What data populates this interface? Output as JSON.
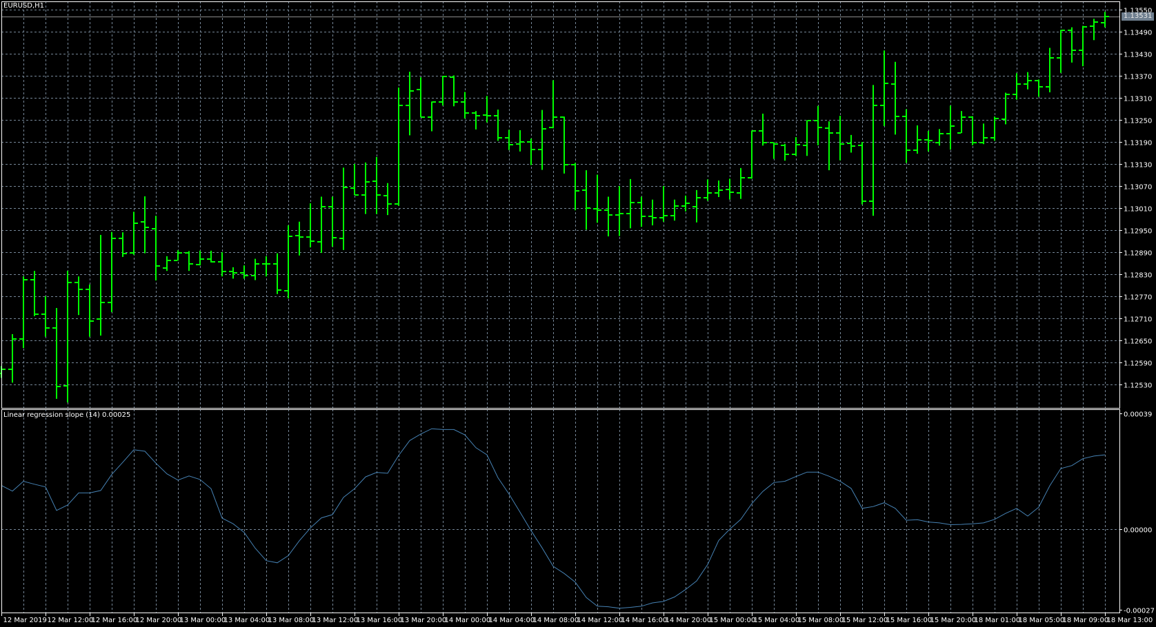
{
  "window": {
    "symbol_label": "EURUSD,H1"
  },
  "colors": {
    "background": "#000000",
    "grid": "#778899",
    "bars": "#00ff00",
    "indicator": "#4682b4",
    "axis": "#ffffff",
    "bid_line": "#8c8c8c"
  },
  "price_axis": {
    "labels": [
      "1.13550",
      "1.13490",
      "1.13430",
      "1.13370",
      "1.13310",
      "1.13250",
      "1.13190",
      "1.13130",
      "1.13070",
      "1.13010",
      "1.12950",
      "1.12890",
      "1.12830",
      "1.12770",
      "1.12710",
      "1.12650",
      "1.12590",
      "1.12530"
    ],
    "bid_price": "1.13531"
  },
  "indicator": {
    "title": "Linear regression slope (14) 0.00025",
    "axis_labels": [
      "0.00039",
      "0.00000",
      "-0.00027"
    ],
    "axis_values": [
      0.00039,
      0.0,
      -0.00027
    ],
    "values": [
      0.000147,
      0.000128,
      0.000161,
      0.000151,
      0.000142,
      6.3e-05,
      8.1e-05,
      0.000122,
      0.000122,
      0.00013,
      0.000184,
      0.000225,
      0.000267,
      0.000262,
      0.000222,
      0.000186,
      0.000165,
      0.000179,
      0.000167,
      0.000136,
      3.7e-05,
      1.8e-05,
      -1.1e-05,
      -6.4e-05,
      -0.000106,
      -0.000113,
      -8.9e-05,
      -3.9e-05,
      4e-06,
      3.8e-05,
      4.9e-05,
      0.000107,
      0.000136,
      0.000176,
      0.000191,
      0.000188,
      0.000248,
      0.000298,
      0.00032,
      0.000338,
      0.000335,
      0.000335,
      0.000317,
      0.000274,
      0.00025,
      0.000173,
      0.000118,
      5.7e-05,
      -5e-06,
      -6.3e-05,
      -0.000125,
      -0.000149,
      -0.000178,
      -0.00023,
      -0.000259,
      -0.000261,
      -0.000266,
      -0.000263,
      -0.000259,
      -0.000248,
      -0.000243,
      -0.000228,
      -0.000203,
      -0.000174,
      -0.000119,
      -3.8e-05,
      0.0,
      3.3e-05,
      8.6e-05,
      0.000127,
      0.000157,
      0.000161,
      0.000177,
      0.000192,
      0.000192,
      0.000178,
      0.000161,
      0.000137,
      7e-05,
      7.6e-05,
      8.9e-05,
      7e-05,
      3e-05,
      3.2e-05,
      2.4e-05,
      2.1e-05,
      1.5e-05,
      1.6e-05,
      1.8e-05,
      2.1e-05,
      3.3e-05,
      5.3e-05,
      7e-05,
      4.4e-05,
      7.4e-05,
      0.000146,
      0.000204,
      0.000214,
      0.000237,
      0.000246,
      0.00025
    ]
  },
  "time_axis": {
    "labels": [
      "12 Mar 2019",
      "12 Mar 12:00",
      "12 Mar 16:00",
      "12 Mar 20:00",
      "13 Mar 00:00",
      "13 Mar 04:00",
      "13 Mar 08:00",
      "13 Mar 12:00",
      "13 Mar 16:00",
      "13 Mar 20:00",
      "14 Mar 00:00",
      "14 Mar 04:00",
      "14 Mar 08:00",
      "14 Mar 12:00",
      "14 Mar 16:00",
      "14 Mar 20:00",
      "15 Mar 00:00",
      "15 Mar 04:00",
      "15 Mar 08:00",
      "15 Mar 12:00",
      "15 Mar 16:00",
      "15 Mar 20:00",
      "18 Mar 01:00",
      "18 Mar 05:00",
      "18 Mar 09:00",
      "18 Mar 13:00"
    ],
    "bars_per_label": 4
  },
  "chart_data": {
    "type": "ohlc",
    "title": "EURUSD,H1",
    "price_range": [
      1.1247,
      1.13572
    ],
    "ohlc": [
      [
        1.1256,
        1.1258,
        1.12548,
        1.12571
      ],
      [
        1.12572,
        1.12667,
        1.12535,
        1.12653
      ],
      [
        1.12653,
        1.12824,
        1.12629,
        1.12815
      ],
      [
        1.12815,
        1.12839,
        1.12716,
        1.12722
      ],
      [
        1.12722,
        1.1277,
        1.1266,
        1.12683
      ],
      [
        1.12683,
        1.12738,
        1.12491,
        1.12525
      ],
      [
        1.12527,
        1.12839,
        1.12481,
        1.12808
      ],
      [
        1.12807,
        1.12824,
        1.12719,
        1.12789
      ],
      [
        1.12789,
        1.12802,
        1.1266,
        1.12703
      ],
      [
        1.12708,
        1.12937,
        1.12663,
        1.12754
      ],
      [
        1.12754,
        1.12945,
        1.12727,
        1.12928
      ],
      [
        1.12928,
        1.12944,
        1.12877,
        1.12887
      ],
      [
        1.12889,
        1.13,
        1.12883,
        1.12969
      ],
      [
        1.12972,
        1.13042,
        1.12887,
        1.12957
      ],
      [
        1.12953,
        1.12989,
        1.12813,
        1.12853
      ],
      [
        1.12846,
        1.12879,
        1.12839,
        1.12868
      ],
      [
        1.12868,
        1.12895,
        1.12867,
        1.12889
      ],
      [
        1.12889,
        1.12893,
        1.12839,
        1.12859
      ],
      [
        1.12857,
        1.12894,
        1.12854,
        1.12872
      ],
      [
        1.12872,
        1.12894,
        1.12862,
        1.12864
      ],
      [
        1.12864,
        1.1289,
        1.12824,
        1.12837
      ],
      [
        1.12837,
        1.12849,
        1.12818,
        1.12834
      ],
      [
        1.12834,
        1.12854,
        1.12818,
        1.12826
      ],
      [
        1.12826,
        1.12872,
        1.12814,
        1.12859
      ],
      [
        1.12859,
        1.12879,
        1.12824,
        1.12859
      ],
      [
        1.12859,
        1.12887,
        1.12776,
        1.12786
      ],
      [
        1.12785,
        1.12963,
        1.12764,
        1.12934
      ],
      [
        1.12935,
        1.12973,
        1.12881,
        1.12931
      ],
      [
        1.12931,
        1.13023,
        1.12903,
        1.1292
      ],
      [
        1.12919,
        1.13041,
        1.12888,
        1.13014
      ],
      [
        1.13014,
        1.13041,
        1.12905,
        1.1293
      ],
      [
        1.12928,
        1.1312,
        1.12896,
        1.13066
      ],
      [
        1.13065,
        1.1313,
        1.13045,
        1.13046
      ],
      [
        1.13046,
        1.13134,
        1.12994,
        1.13081
      ],
      [
        1.13084,
        1.13149,
        1.12994,
        1.13046
      ],
      [
        1.13044,
        1.13078,
        1.12991,
        1.13021
      ],
      [
        1.13021,
        1.13338,
        1.13016,
        1.1329
      ],
      [
        1.13289,
        1.13381,
        1.13208,
        1.13329
      ],
      [
        1.13333,
        1.13366,
        1.13257,
        1.13258
      ],
      [
        1.13258,
        1.133,
        1.13219,
        1.13299
      ],
      [
        1.13298,
        1.1337,
        1.13289,
        1.13369
      ],
      [
        1.13366,
        1.13371,
        1.13287,
        1.13299
      ],
      [
        1.13299,
        1.13326,
        1.13254,
        1.13268
      ],
      [
        1.13268,
        1.13274,
        1.13224,
        1.13261
      ],
      [
        1.13264,
        1.13315,
        1.13243,
        1.13261
      ],
      [
        1.13261,
        1.13278,
        1.13193,
        1.13201
      ],
      [
        1.13201,
        1.13223,
        1.13168,
        1.13183
      ],
      [
        1.13185,
        1.13222,
        1.13164,
        1.1319
      ],
      [
        1.1319,
        1.13199,
        1.13127,
        1.1317
      ],
      [
        1.1317,
        1.13277,
        1.13114,
        1.13226
      ],
      [
        1.1323,
        1.13358,
        1.13227,
        1.13258
      ],
      [
        1.13258,
        1.13259,
        1.13104,
        1.13129
      ],
      [
        1.13129,
        1.13133,
        1.13004,
        1.13057
      ],
      [
        1.13058,
        1.13113,
        1.12951,
        1.1301
      ],
      [
        1.13009,
        1.13101,
        1.1297,
        1.13005
      ],
      [
        1.13005,
        1.13041,
        1.12933,
        1.12991
      ],
      [
        1.12991,
        1.1307,
        1.12934,
        1.12995
      ],
      [
        1.12995,
        1.13089,
        1.12955,
        1.13025
      ],
      [
        1.13025,
        1.13041,
        1.12959,
        1.12988
      ],
      [
        1.12988,
        1.13033,
        1.12963,
        1.12983
      ],
      [
        1.12984,
        1.1307,
        1.12973,
        1.1299
      ],
      [
        1.1299,
        1.13033,
        1.12976,
        1.13016
      ],
      [
        1.13016,
        1.13044,
        1.13001,
        1.13024
      ],
      [
        1.13014,
        1.13059,
        1.12971,
        1.13038
      ],
      [
        1.13038,
        1.13088,
        1.1303,
        1.13051
      ],
      [
        1.13051,
        1.13085,
        1.1304,
        1.13058
      ],
      [
        1.1306,
        1.1309,
        1.13033,
        1.13054
      ],
      [
        1.13051,
        1.13119,
        1.13035,
        1.13093
      ],
      [
        1.13092,
        1.13221,
        1.1309,
        1.1322
      ],
      [
        1.1322,
        1.13267,
        1.1318,
        1.13189
      ],
      [
        1.13189,
        1.13189,
        1.13144,
        1.13185
      ],
      [
        1.13181,
        1.13185,
        1.13139,
        1.13156
      ],
      [
        1.13156,
        1.13203,
        1.13152,
        1.13183
      ],
      [
        1.13181,
        1.13249,
        1.13152,
        1.13249
      ],
      [
        1.13249,
        1.13288,
        1.13181,
        1.1323
      ],
      [
        1.13228,
        1.13246,
        1.13113,
        1.13215
      ],
      [
        1.13215,
        1.13261,
        1.1314,
        1.13185
      ],
      [
        1.13186,
        1.13209,
        1.13161,
        1.13179
      ],
      [
        1.13181,
        1.1319,
        1.1302,
        1.13029
      ],
      [
        1.13029,
        1.13345,
        1.12989,
        1.1329
      ],
      [
        1.1329,
        1.13439,
        1.13233,
        1.1335
      ],
      [
        1.13348,
        1.13408,
        1.1321,
        1.1326
      ],
      [
        1.1326,
        1.13279,
        1.13133,
        1.13168
      ],
      [
        1.13168,
        1.13235,
        1.13158,
        1.13196
      ],
      [
        1.13196,
        1.1322,
        1.13164,
        1.13193
      ],
      [
        1.13189,
        1.13225,
        1.1318,
        1.13213
      ],
      [
        1.13213,
        1.13289,
        1.13169,
        1.13234
      ],
      [
        1.13215,
        1.13274,
        1.13214,
        1.13257
      ],
      [
        1.13257,
        1.1326,
        1.13181,
        1.13189
      ],
      [
        1.13189,
        1.1324,
        1.13184,
        1.13201
      ],
      [
        1.13201,
        1.13259,
        1.13193,
        1.13254
      ],
      [
        1.13252,
        1.13324,
        1.13238,
        1.1332
      ],
      [
        1.1332,
        1.13377,
        1.13305,
        1.13347
      ],
      [
        1.13347,
        1.1338,
        1.13333,
        1.13357
      ],
      [
        1.13357,
        1.1336,
        1.13313,
        1.1334
      ],
      [
        1.1334,
        1.13446,
        1.13325,
        1.13419
      ],
      [
        1.13419,
        1.13495,
        1.13378,
        1.13493
      ],
      [
        1.13494,
        1.13502,
        1.13406,
        1.1344
      ],
      [
        1.1344,
        1.13506,
        1.13396,
        1.13504
      ],
      [
        1.13505,
        1.13525,
        1.13467,
        1.13516
      ],
      [
        1.13515,
        1.13544,
        1.13502,
        1.13531
      ]
    ]
  }
}
